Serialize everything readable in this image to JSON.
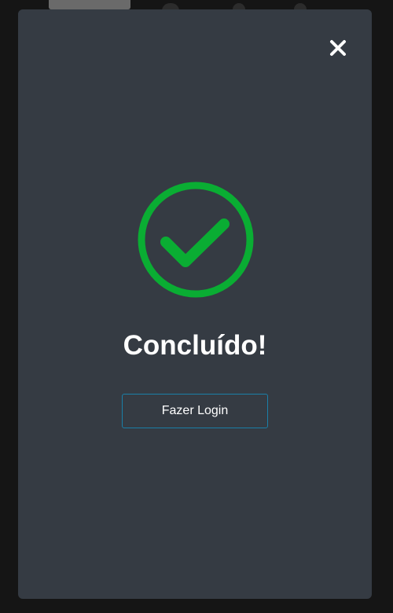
{
  "modal": {
    "title": "Concluído!",
    "login_button_label": "Fazer Login",
    "icons": {
      "close": "close-icon",
      "success": "check-circle-icon"
    }
  },
  "colors": {
    "modal_background": "#353b43",
    "backdrop": "#151515",
    "success_green": "#0aad33",
    "button_border": "#1a7fa8",
    "text": "#ffffff"
  }
}
